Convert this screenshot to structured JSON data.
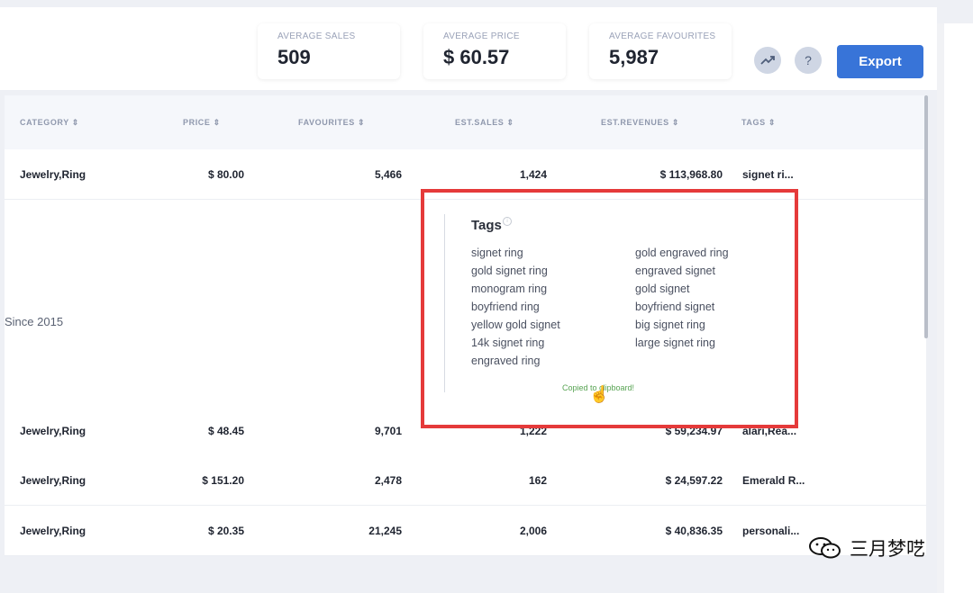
{
  "stats": [
    {
      "label": "AVERAGE SALES",
      "value": "509"
    },
    {
      "label": "AVERAGE PRICE",
      "value": "$ 60.57"
    },
    {
      "label": "AVERAGE FAVOURITES",
      "value": "5,987"
    }
  ],
  "toolbar": {
    "trend_icon": "trending-up-icon",
    "help_label": "?",
    "export_label": "Export"
  },
  "table": {
    "headers": [
      "CATEGORY ⇕",
      "PRICE ⇕",
      "FAVOURITES ⇕",
      "EST.SALES ⇕",
      "EST.REVENUES ⇕",
      "TAGS ⇕"
    ],
    "rows": [
      {
        "category": "Jewelry,Ring",
        "price": "$ 80.00",
        "favourites": "5,466",
        "sales": "1,424",
        "revenues": "$ 113,968.80",
        "tags": "signet ri..."
      },
      {
        "category": "Jewelry,Ring",
        "price": "$ 48.45",
        "favourites": "9,701",
        "sales": "1,222",
        "revenues": "$ 59,234.97",
        "tags": "alari,Rea..."
      },
      {
        "category": "Jewelry,Ring",
        "price": "$ 151.20",
        "favourites": "2,478",
        "sales": "162",
        "revenues": "$ 24,597.22",
        "tags": "Emerald R..."
      },
      {
        "category": "Jewelry,Ring",
        "price": "$ 20.35",
        "favourites": "21,245",
        "sales": "2,006",
        "revenues": "$ 40,836.35",
        "tags": "personali..."
      }
    ],
    "since_text": "Since 2015"
  },
  "tags_popup": {
    "title": "Tags",
    "left_tags": [
      "signet ring",
      "gold signet ring",
      "monogram ring",
      "boyfriend ring",
      "yellow gold signet",
      "14k signet ring",
      "engraved ring"
    ],
    "right_tags": [
      "gold engraved ring",
      "engraved signet",
      "gold signet",
      "boyfriend signet",
      "big signet ring",
      "large signet ring"
    ],
    "copied_message": "Copied to clipboard!"
  },
  "watermark": {
    "text": "三月梦呓"
  },
  "colors": {
    "accent": "#3874d8",
    "highlight": "#e53a3a",
    "success": "#58a453"
  }
}
